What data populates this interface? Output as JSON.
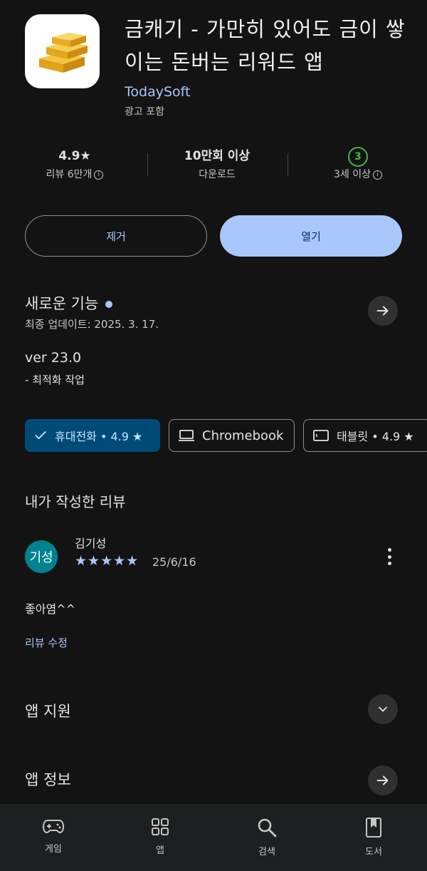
{
  "app": {
    "title": "금캐기 - 가만히 있어도 금이 쌓이는 돈버는 리워드 앱",
    "developer": "TodaySoft",
    "ad_label": "광고 포함"
  },
  "stats": {
    "rating": "4.9★",
    "reviews": "리뷰 6만개",
    "downloads": "10만회 이상",
    "downloads_label": "다운로드",
    "age_badge": "3",
    "age_label": "3세 이상"
  },
  "buttons": {
    "uninstall": "제거",
    "open": "열기"
  },
  "whats_new": {
    "title": "새로운 기능",
    "updated": "최종 업데이트: 2025. 3. 17.",
    "version": "ver 23.0",
    "note": "- 최적화 작업"
  },
  "device_chips": [
    {
      "label": "휴대전화 • 4.9 ★"
    },
    {
      "label": "Chromebook"
    },
    {
      "label": "태블릿 • 4.9 ★"
    }
  ],
  "my_review": {
    "title": "내가 작성한 리뷰",
    "avatar_text": "기성",
    "reviewer": "김기성",
    "stars": "★★★★★",
    "rating_value": 5,
    "date": "25/6/16",
    "text": "좋아염^^",
    "edit_label": "리뷰 수정"
  },
  "sections": {
    "app_support": "앱 지원",
    "app_info": "앱 정보"
  },
  "bottom_nav": [
    {
      "label": "게임",
      "icon": "gamepad-icon"
    },
    {
      "label": "앱",
      "icon": "apps-grid-icon"
    },
    {
      "label": "검색",
      "icon": "search-icon"
    },
    {
      "label": "도서",
      "icon": "bookmark-book-icon"
    }
  ],
  "colors": {
    "background": "#131313",
    "accent": "#a8c7fa",
    "chip_selected": "#004a77",
    "avatar": "#00838f",
    "age_badge": "#4caf50"
  }
}
